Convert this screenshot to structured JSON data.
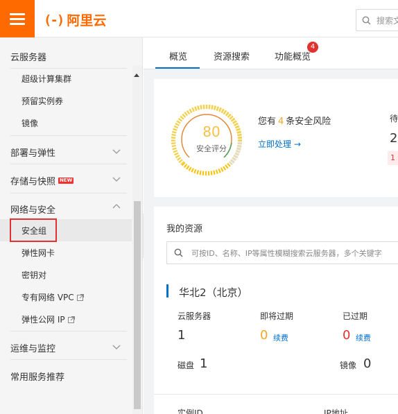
{
  "header": {
    "logo_mark": "(-)",
    "logo_text": "阿里云",
    "search_placeholder": "搜索文"
  },
  "sidebar": {
    "title": "云服务器",
    "top_items": [
      "超级计算集群",
      "预留实例券",
      "镜像"
    ],
    "groups": {
      "deploy": "部署与弹性",
      "storage": "存储与快照",
      "storage_badge": "NEW",
      "network": "网络与安全",
      "ops": "运维与监控",
      "recommend": "常用服务推荐"
    },
    "network_items": [
      "安全组",
      "弹性网卡",
      "密钥对",
      "专有网络 VPC",
      "弹性公网 IP"
    ]
  },
  "tabs": {
    "overview": "概览",
    "resource_search": "资源搜索",
    "features": "功能概览",
    "features_badge": "4"
  },
  "security": {
    "score": "80",
    "score_label": "安全评分",
    "risk_prefix": "您有",
    "risk_count": "4",
    "risk_suffix": "条安全风险",
    "handle_now": "立即处理 →",
    "pending_label": "待",
    "pending_value": "2",
    "pending_red": "1"
  },
  "resources": {
    "title": "我的资源",
    "search_placeholder": "可按ID、名称、IP等属性模糊搜索云服务器，多个关键字",
    "region": "华北2（北京）",
    "servers_label": "云服务器",
    "servers_value": "1",
    "expiring_label": "即将过期",
    "expiring_value": "0",
    "expired_label": "已过期",
    "expired_value": "0",
    "renew": "续费",
    "disk_label": "磁盘",
    "disk_value": "1",
    "image_label": "镜像",
    "image_value": "0",
    "col_instance": "实例ID",
    "col_ip": "IP地址"
  },
  "colors": {
    "brand": "#ff6a00",
    "link": "#0070cc",
    "danger": "#e0322f",
    "warning": "#f5a623"
  }
}
